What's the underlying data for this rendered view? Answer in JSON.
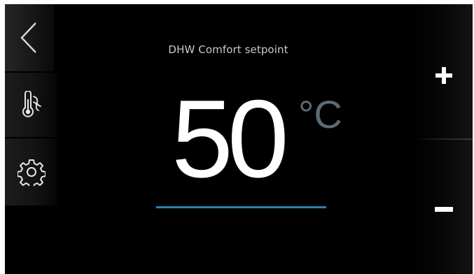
{
  "header": {
    "title": "DHW Comfort setpoint"
  },
  "setpoint": {
    "value": "50",
    "unit": "°C"
  },
  "sidebar": {
    "items": [
      {
        "icon": "back-chevron-icon"
      },
      {
        "icon": "thermometer-hot-water-icon"
      },
      {
        "icon": "gear-icon"
      }
    ]
  },
  "controls": {
    "increase_icon": "plus-icon",
    "decrease_icon": "minus-icon"
  },
  "colors": {
    "background": "#000000",
    "value": "#ffffff",
    "unit": "#5a6b76",
    "accent_underline": "#2f7fad",
    "title": "#c9c9c9"
  }
}
